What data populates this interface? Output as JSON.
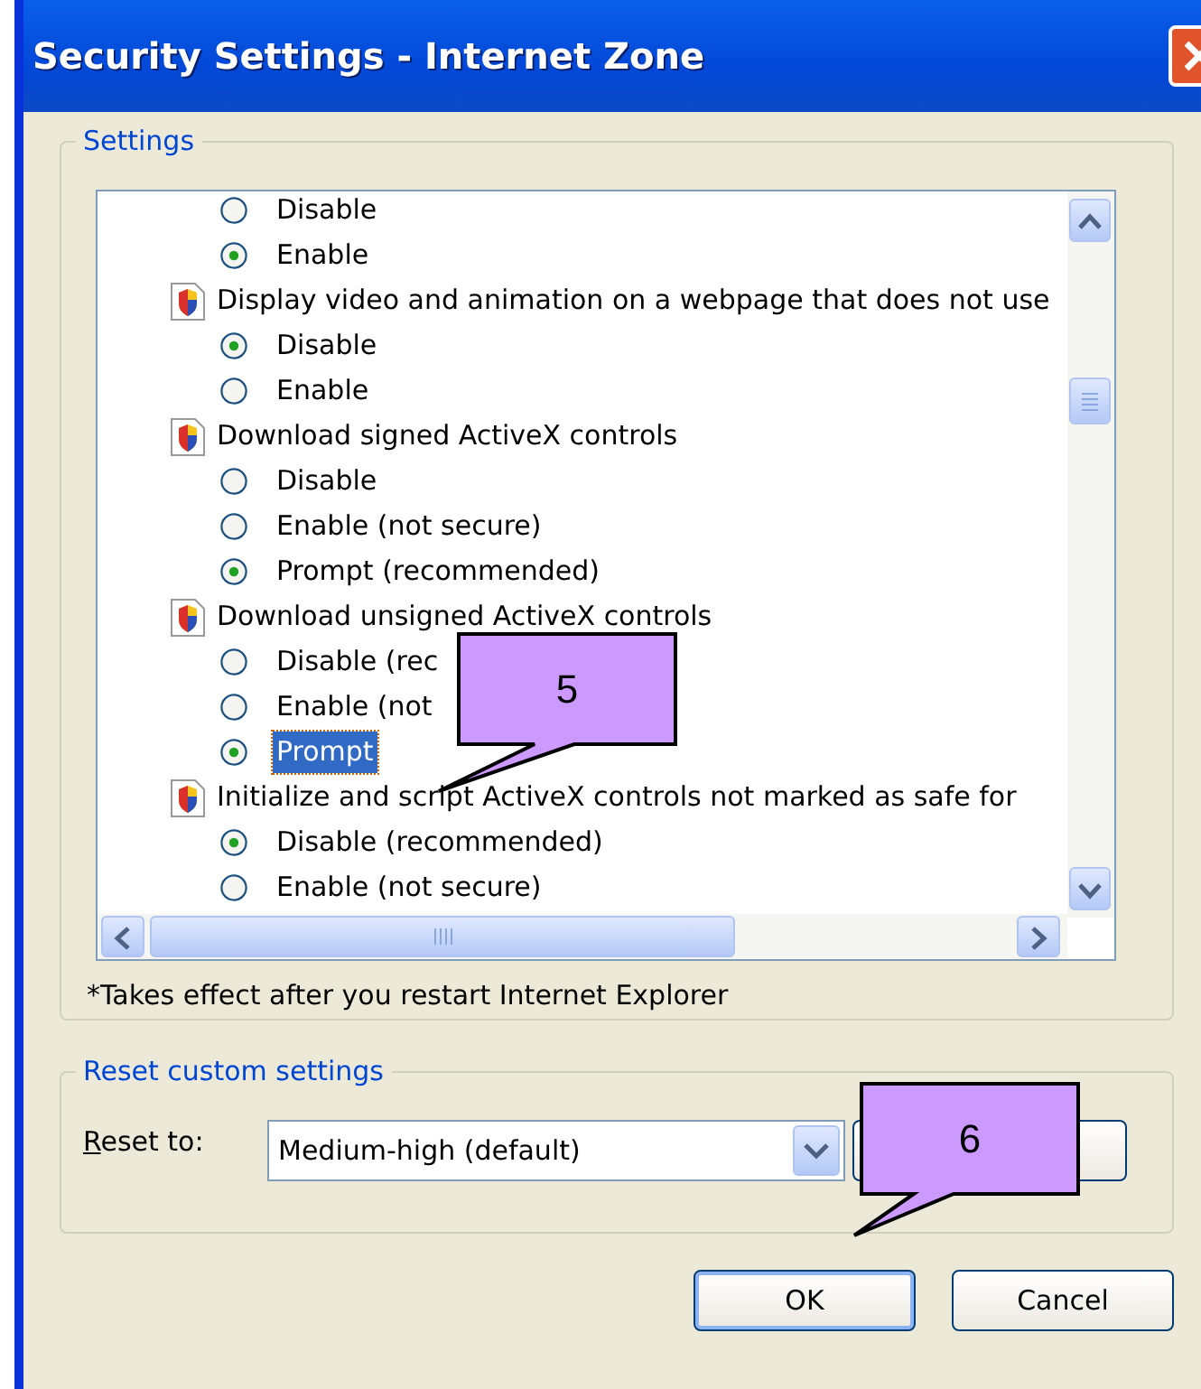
{
  "window": {
    "title": "Security Settings - Internet Zone"
  },
  "settings": {
    "legend": "Settings",
    "items": [
      {
        "kind": "option",
        "label": "Disable",
        "selected": false,
        "highlighted": false
      },
      {
        "kind": "option",
        "label": "Enable",
        "selected": true,
        "highlighted": false
      },
      {
        "kind": "heading",
        "label": "Display video and animation on a webpage that does not use"
      },
      {
        "kind": "option",
        "label": "Disable",
        "selected": true,
        "highlighted": false
      },
      {
        "kind": "option",
        "label": "Enable",
        "selected": false,
        "highlighted": false
      },
      {
        "kind": "heading",
        "label": "Download signed ActiveX controls"
      },
      {
        "kind": "option",
        "label": "Disable",
        "selected": false,
        "highlighted": false
      },
      {
        "kind": "option",
        "label": "Enable (not secure)",
        "selected": false,
        "highlighted": false
      },
      {
        "kind": "option",
        "label": "Prompt (recommended)",
        "selected": true,
        "highlighted": false
      },
      {
        "kind": "heading",
        "label": "Download unsigned ActiveX controls"
      },
      {
        "kind": "option",
        "label": "Disable (rec",
        "selected": false,
        "highlighted": false
      },
      {
        "kind": "option",
        "label": "Enable (not",
        "selected": false,
        "highlighted": false
      },
      {
        "kind": "option",
        "label": "Prompt",
        "selected": true,
        "highlighted": true
      },
      {
        "kind": "heading",
        "label": "Initialize and script ActiveX controls not marked as safe for"
      },
      {
        "kind": "option",
        "label": "Disable (recommended)",
        "selected": true,
        "highlighted": false
      },
      {
        "kind": "option",
        "label": "Enable (not secure)",
        "selected": false,
        "highlighted": false
      }
    ],
    "note": "*Takes effect after you restart Internet Explorer"
  },
  "reset": {
    "legend": "Reset custom settings",
    "label": "Reset to:",
    "value": "Medium-high (default)"
  },
  "buttons": [
    "OK",
    "Cancel"
  ],
  "callouts": [
    {
      "text": "5"
    },
    {
      "text": "6"
    }
  ]
}
